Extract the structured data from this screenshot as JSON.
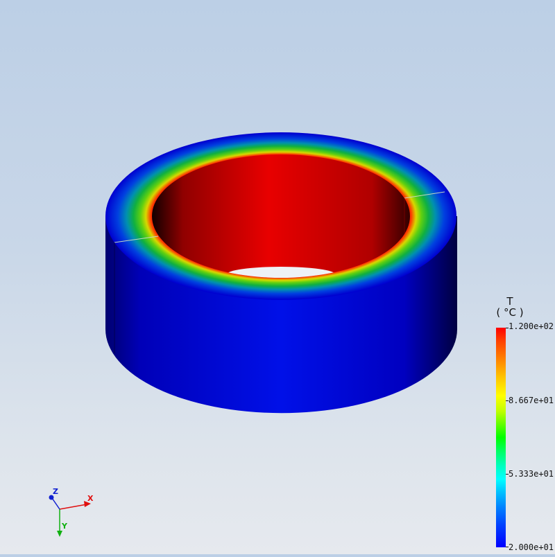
{
  "legend": {
    "variable": "T",
    "unit": "( °C )",
    "max_label": "1.200e+02",
    "mid_high_label": "8.667e+01",
    "mid_low_label": "5.333e+01",
    "min_label": "2.000e+01",
    "colors": {
      "max": "#ff0000",
      "min": "#0000ff"
    }
  },
  "triad": {
    "x_label": "X",
    "y_label": "Y",
    "z_label": "Z",
    "colors": {
      "x": "#e01010",
      "y": "#10b010",
      "z": "#1020d0"
    }
  },
  "model": {
    "colors": {
      "hot": "#e00000",
      "cold": "#0000e0"
    }
  }
}
